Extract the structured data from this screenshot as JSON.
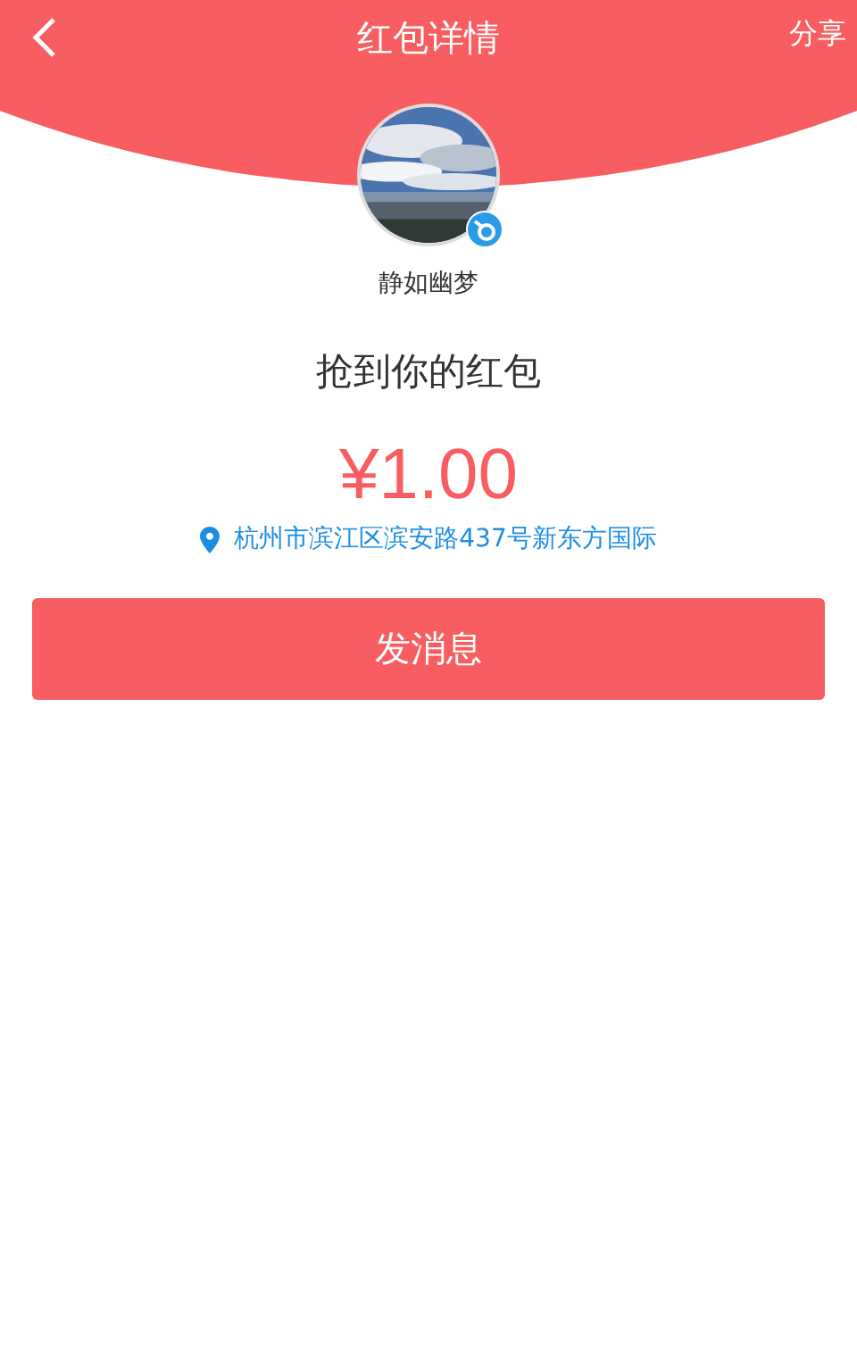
{
  "header": {
    "title": "红包详情",
    "action": "分享"
  },
  "profile": {
    "name": "静如幽梦"
  },
  "message": "抢到你的红包",
  "amount": "¥1.00",
  "location": "杭州市滨江区滨安路437号新东方国际",
  "button": "发消息"
}
